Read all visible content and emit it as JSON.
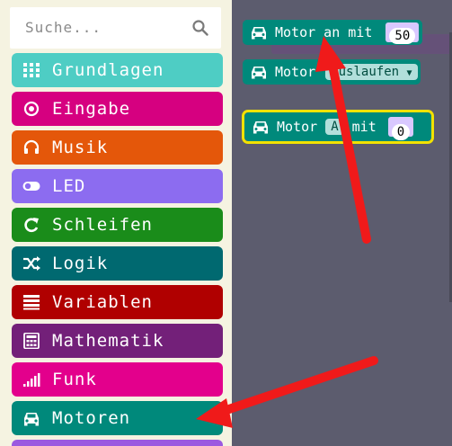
{
  "search": {
    "placeholder": "Suche..."
  },
  "categories": [
    {
      "label": "Grundlagen",
      "icon": "grid-icon",
      "color": "#4ecdc4"
    },
    {
      "label": "Eingabe",
      "icon": "target-icon",
      "color": "#d60080"
    },
    {
      "label": "Musik",
      "icon": "headphones-icon",
      "color": "#e4570a"
    },
    {
      "label": "LED",
      "icon": "toggle-icon",
      "color": "#8c6cf0"
    },
    {
      "label": "Schleifen",
      "icon": "refresh-icon",
      "color": "#1a8c1a"
    },
    {
      "label": "Logik",
      "icon": "shuffle-icon",
      "color": "#006970"
    },
    {
      "label": "Variablen",
      "icon": "list-icon",
      "color": "#b00000"
    },
    {
      "label": "Mathematik",
      "icon": "calculator-icon",
      "color": "#732079"
    },
    {
      "label": "Funk",
      "icon": "signal-icon",
      "color": "#e3008c"
    },
    {
      "label": "Motoren",
      "icon": "car-icon",
      "color": "#00897b"
    }
  ],
  "blocks": {
    "motor_on": {
      "label": "Motor an mit",
      "value": "50"
    },
    "motor_coast": {
      "label": "Motor",
      "dropdown": "auslaufen"
    },
    "motor_a": {
      "label": "Motor",
      "motor": "A",
      "with": "mit",
      "value": "0"
    }
  },
  "colors": {
    "workspace": "#5c5c6e",
    "toolbox": "#f5f3e1",
    "motor_block": "#00897b",
    "arrow": "#f01a1a",
    "selected_outline": "#f2e200"
  }
}
